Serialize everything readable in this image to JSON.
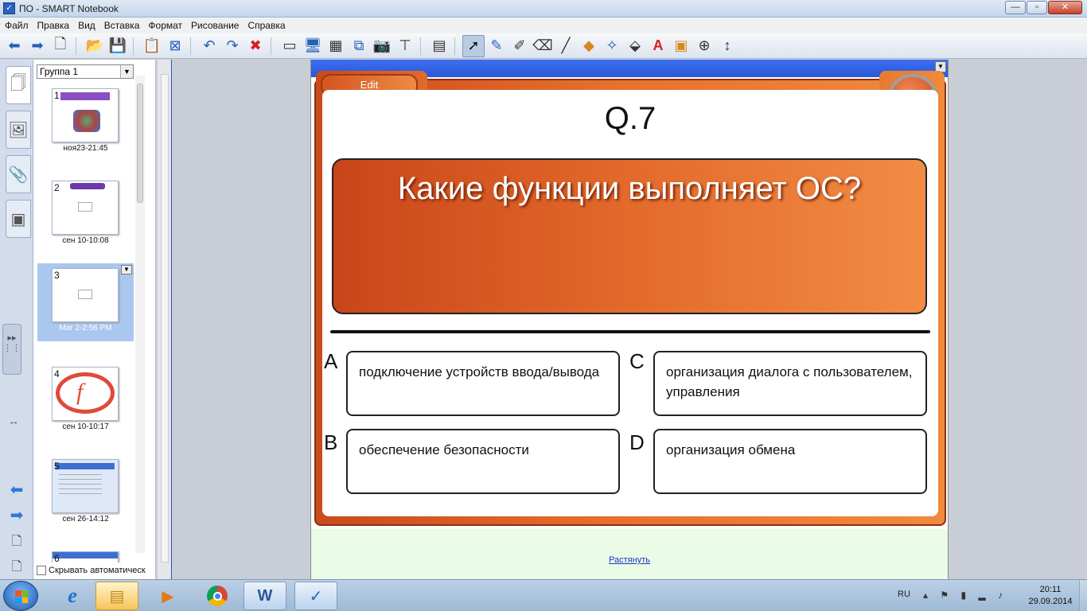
{
  "window": {
    "title": "ПО - SMART Notebook",
    "minimize": "—",
    "maximize": "▫",
    "close": "✕"
  },
  "menu": [
    "Файл",
    "Правка",
    "Вид",
    "Вставка",
    "Формат",
    "Рисование",
    "Справка"
  ],
  "toolbar": {
    "icons": [
      "back-arrow-icon",
      "forward-arrow-icon",
      "add-page-icon",
      "open-folder-icon",
      "save-icon",
      "paste-icon",
      "delete-page-icon",
      "undo-icon",
      "redo-icon",
      "delete-icon",
      "screen-shade-icon",
      "full-screen-icon",
      "transparent-background-icon",
      "dual-page-icon",
      "screen-capture-icon",
      "document-camera-icon",
      "table-icon",
      "select-icon",
      "pen-icon",
      "creative-pen-icon",
      "eraser-icon",
      "line-icon",
      "shapes-icon",
      "magic-pen-icon",
      "fill-icon",
      "text-icon",
      "properties-icon",
      "measure-tools-icon",
      "move-toolbar-icon"
    ]
  },
  "sorter": {
    "group": "Группа 1",
    "autohide_label": "Скрывать автоматическ",
    "pages": [
      {
        "num": "1",
        "caption": "ноя23-21:45"
      },
      {
        "num": "2",
        "caption": "сен 10-10:08"
      },
      {
        "num": "3",
        "caption": "Mar 2-2:56 PM"
      },
      {
        "num": "4",
        "caption": "сен 10-10:17"
      },
      {
        "num": "5",
        "caption": "сен 26-14:12"
      },
      {
        "num": "6",
        "caption": ""
      }
    ]
  },
  "quiz": {
    "edit_label": "Edit",
    "help_label": "?",
    "number": "Q.7",
    "question": "Какие функции выполняет ОС?",
    "options": [
      {
        "letter": "A",
        "text": "подключение устройств ввода/вывода"
      },
      {
        "letter": "C",
        "text": "организация диалога с пользователем, управления"
      },
      {
        "letter": "B",
        "text": "обеспечение безопасности"
      },
      {
        "letter": "D",
        "text": "организация обмена"
      }
    ]
  },
  "stretch_link": "Растянуть",
  "taskbar": {
    "apps": [
      "internet-explorer-icon",
      "file-explorer-icon",
      "media-player-icon",
      "chrome-icon",
      "word-icon",
      "smart-notebook-icon"
    ],
    "lang": "RU",
    "time": "20:11",
    "date": "29.09.2014"
  },
  "colors": {
    "accent_orange": "#e8722d",
    "page_bar_blue": "#2a57d8",
    "stretch_bg": "#eafbe6"
  }
}
